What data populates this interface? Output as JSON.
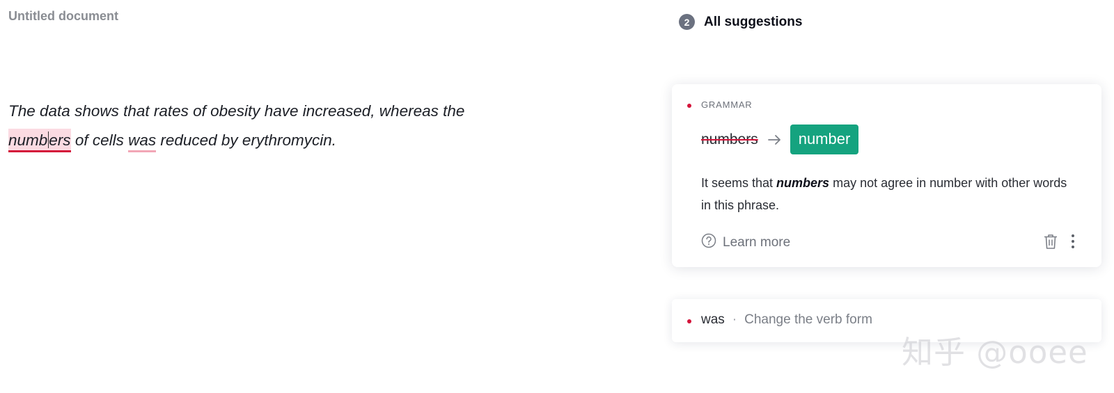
{
  "document": {
    "title": "Untitled document",
    "line1": "The data shows that rates of obesity have increased, whereas the",
    "flagged_word_1_part_a": "numb",
    "flagged_word_1_part_b": "ers",
    "text_between": " of cells ",
    "flagged_word_2": "was",
    "line2_end": " reduced by erythromycin."
  },
  "suggestions_panel": {
    "count": "2",
    "title": "All suggestions",
    "accent_color": "#d4143a",
    "replacement_color": "#15a37f",
    "card1": {
      "category": "GRAMMAR",
      "old_word": "numbers",
      "new_word": "number",
      "explain_prefix": "It seems that ",
      "explain_word": "numbers",
      "explain_suffix": " may not agree in number with other words in this phrase.",
      "learn_more": "Learn more",
      "icons": [
        "question-circle-icon",
        "trash-icon",
        "more-vertical-icon",
        "arrow-right-icon"
      ]
    },
    "card2": {
      "word": "was",
      "separator": "·",
      "hint": "Change the verb form"
    }
  },
  "watermark": "知乎 @ooee"
}
